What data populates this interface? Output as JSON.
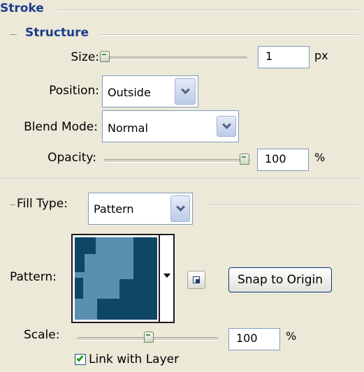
{
  "stroke": {
    "title": "Stroke",
    "structure": {
      "title": "Structure",
      "size": {
        "label": "Size:",
        "value": "1",
        "unit": "px",
        "slider_level": 0.01
      },
      "position": {
        "label": "Position:",
        "selected": "Outside"
      },
      "blend_mode": {
        "label": "Blend Mode:",
        "selected": "Normal"
      },
      "opacity": {
        "label": "Opacity:",
        "value": "100",
        "unit": "%",
        "slider_level": 1.0
      }
    },
    "fill_type": {
      "label": "Fill Type:",
      "selected": "Pattern"
    },
    "pattern": {
      "label": "Pattern:",
      "light_color": "#5a8fb0",
      "dark_color": "#0f4565",
      "snap_button": "Snap to Origin",
      "new_preset_icon": "new-preset-icon"
    },
    "scale": {
      "label": "Scale:",
      "value": "100",
      "unit": "%",
      "slider_level": 0.5
    },
    "link_with_layer": {
      "label": "Link with Layer",
      "checked": true
    }
  }
}
